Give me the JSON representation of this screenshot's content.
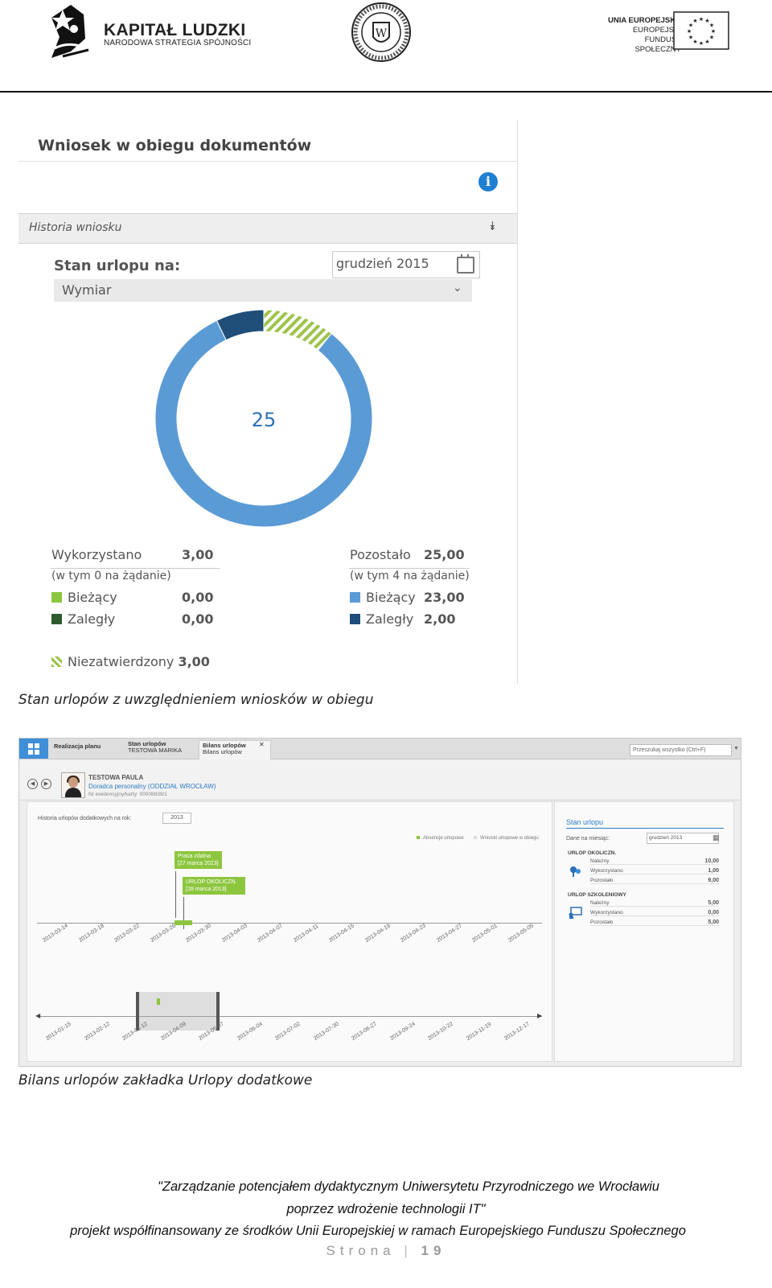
{
  "header": {
    "kl_title": "KAPITAŁ LUDZKI",
    "kl_subtitle": "NARODOWA STRATEGIA SPÓJNOŚCI",
    "ue_line1": "UNIA EUROPEJSKA",
    "ue_line2": "EUROPEJSKI",
    "ue_line3": "FUNDUSZ SPOŁECZNY"
  },
  "panel1": {
    "title": "Wniosek w obiegu dokumentów",
    "history_label": "Historia wniosku",
    "stan_label": "Stan urlopu na:",
    "month_value": "grudzień 2015",
    "wymiar_label": "Wymiar",
    "donut_center": "25",
    "left": {
      "used_label": "Wykorzystano",
      "used_value": "3,00",
      "note": "(w tym 0 na żądanie)",
      "current_label": "Bieżący",
      "current_value": "0,00",
      "overdue_label": "Zaległy",
      "overdue_value": "0,00"
    },
    "right": {
      "left_label": "Pozostało",
      "left_value": "25,00",
      "note": "(w tym 4 na żądanie)",
      "current_label": "Bieżący",
      "current_value": "23,00",
      "overdue_label": "Zaległy",
      "overdue_value": "2,00"
    },
    "unapproved_label": "Niezatwierdzony",
    "unapproved_value": "3,00",
    "colors": {
      "current_used": "#8cc63f",
      "overdue_used": "#2e5b2e",
      "current_left": "#5b9bd5",
      "overdue_left": "#1f4e79"
    }
  },
  "chart_data": {
    "type": "pie",
    "categories": [
      "Bieżący (pozostało)",
      "Zaległy (pozostało)",
      "Niezatwierdzony"
    ],
    "values": [
      23.0,
      2.0,
      3.0
    ],
    "center_label": "25"
  },
  "caption1": "Stan urlopów z uwzględnieniem wniosków w obiegu",
  "panel2": {
    "tab1": "Realizacja planu",
    "tab2_line1": "Stan urlopów",
    "tab2_line2": "TESTOWA MARIKA",
    "tab3_line1": "Bilans urlopów",
    "tab3_line2": "Bilans urlopów",
    "search_placeholder": "Przeszukaj wszystko (Ctrl+F)",
    "person_name": "TESTOWA PAULA",
    "person_role": "Doradca personalny  (ODDZIAŁ WROCŁAW)",
    "person_id": "Nr ewidencyjny/karty:  00008839/1",
    "history_label": "Historia urlopów dodatkowych na rok:",
    "year": "2013",
    "legend1": "Absencje urlopowe",
    "legend2": "Wnioski urlopowe w obiegu",
    "event1_title": "Praca zdalna",
    "event1_date": "[27 marca 2013]",
    "event2_title": "URLOP OKOLICZN.",
    "event2_date": "[28 marca 2013]",
    "timeline_dates": [
      "2013-03-14",
      "2013-03-18",
      "2013-03-22",
      "2013-03-26",
      "2013-03-30",
      "2013-04-03",
      "2013-04-07",
      "2013-04-11",
      "2013-04-15",
      "2013-04-19",
      "2013-04-23",
      "2013-04-27",
      "2013-05-01",
      "2013-05-05"
    ],
    "overview_dates": [
      "2013-01-15",
      "2013-02-12",
      "2013-03-12",
      "2013-04-09",
      "2013-05-07",
      "2013-06-04",
      "2013-07-02",
      "2013-07-30",
      "2013-08-27",
      "2013-09-24",
      "2013-10-22",
      "2013-11-19",
      "2013-12-17"
    ],
    "right_title": "Stan urlopu",
    "month_label": "Dane na miesiąc:",
    "month_value": "grudzień 2013",
    "sec1_title": "URLOP OKOLICZN.",
    "sec1_rows": [
      {
        "label": "Należny",
        "value": "10,00"
      },
      {
        "label": "Wykorzystano",
        "value": "1,00"
      },
      {
        "label": "Pozostało",
        "value": "9,00"
      }
    ],
    "sec2_title": "URLOP SZKOLENIOWY",
    "sec2_rows": [
      {
        "label": "Należny",
        "value": "5,00"
      },
      {
        "label": "Wykorzystano",
        "value": "0,00"
      },
      {
        "label": "Pozostało",
        "value": "5,00"
      }
    ]
  },
  "caption2": "Bilans urlopów zakładka Urlopy dodatkowe",
  "footer": {
    "line1": "\"Zarządzanie potencjałem dydaktycznym Uniwersytetu Przyrodniczego we Wrocławiu",
    "line2": "poprzez wdrożenie technologii IT\"",
    "line3": "projekt współfinansowany ze środków Unii Europejskiej w ramach Europejskiego Funduszu Społecznego",
    "page_word": "Strona",
    "page_number": "19"
  }
}
